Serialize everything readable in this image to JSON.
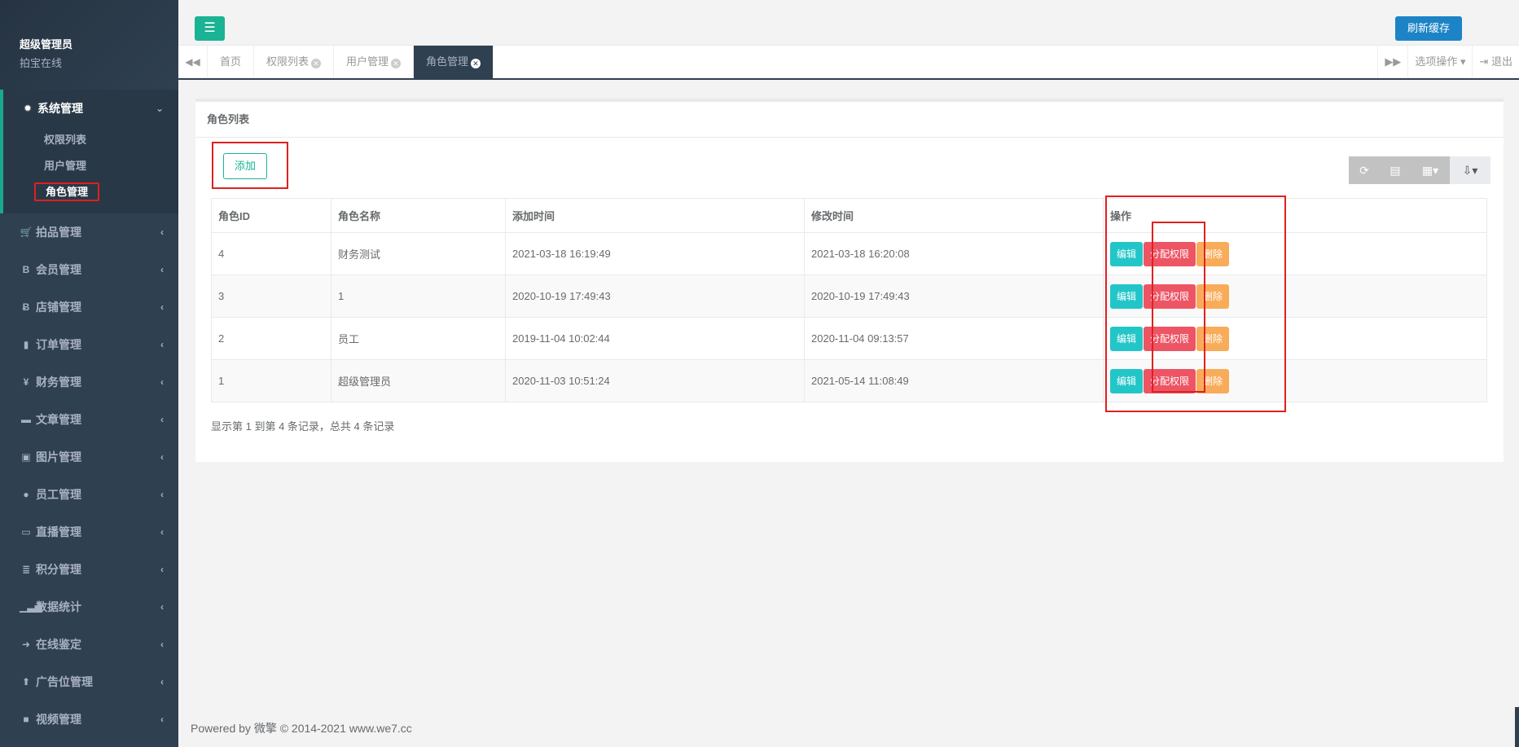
{
  "profile": {
    "name": "超级管理员",
    "role": "拍宝在线"
  },
  "sidebar": {
    "active_group": {
      "icon": "gear-icon",
      "label": "系统管理",
      "children": [
        "权限列表",
        "用户管理",
        "角色管理"
      ]
    },
    "items": [
      {
        "icon": "cart-icon",
        "label": "拍品管理"
      },
      {
        "icon": "bold-b-icon",
        "label": "会员管理"
      },
      {
        "icon": "bitcoin-icon",
        "label": "店铺管理"
      },
      {
        "icon": "book-icon",
        "label": "订单管理"
      },
      {
        "icon": "yen-icon",
        "label": "财务管理"
      },
      {
        "icon": "briefcase-icon",
        "label": "文章管理"
      },
      {
        "icon": "image-icon",
        "label": "图片管理"
      },
      {
        "icon": "user-icon",
        "label": "员工管理"
      },
      {
        "icon": "tv-icon",
        "label": "直播管理"
      },
      {
        "icon": "database-icon",
        "label": "积分管理"
      },
      {
        "icon": "bar-chart-icon",
        "label": "数据统计"
      },
      {
        "icon": "arrow-right-icon",
        "label": "在线鉴定"
      },
      {
        "icon": "arrow-up-icon",
        "label": "广告位管理"
      },
      {
        "icon": "video-icon",
        "label": "视频管理"
      }
    ]
  },
  "topbar": {
    "refresh_label": "刷新缓存"
  },
  "tabs": {
    "items": [
      "首页",
      "权限列表",
      "用户管理",
      "角色管理"
    ],
    "options_label": "选项操作",
    "logout_label": "退出"
  },
  "panel": {
    "title": "角色列表",
    "add_label": "添加",
    "columns": [
      "角色ID",
      "角色名称",
      "添加时间",
      "修改时间",
      "操作"
    ],
    "rows": [
      {
        "id": "4",
        "name": "财务测试",
        "created": "2021-03-18 16:19:49",
        "modified": "2021-03-18 16:20:08"
      },
      {
        "id": "3",
        "name": "1",
        "created": "2020-10-19 17:49:43",
        "modified": "2020-10-19 17:49:43"
      },
      {
        "id": "2",
        "name": "员工",
        "created": "2019-11-04 10:02:44",
        "modified": "2020-11-04 09:13:57"
      },
      {
        "id": "1",
        "name": "超级管理员",
        "created": "2020-11-03 10:51:24",
        "modified": "2021-05-14 11:08:49"
      }
    ],
    "actions": {
      "edit": "编辑",
      "assign": "分配权限",
      "delete": "删除"
    },
    "summary": "显示第 1 到第 4 条记录，总共 4 条记录"
  },
  "footer": "Powered by 微擎 © 2014-2021 www.we7.cc",
  "colors": {
    "sidebar": "#2f4050",
    "accent": "#1ab394",
    "edit": "#23c6c8",
    "assign": "#ed5565",
    "delete": "#f8ac59",
    "highlight": "#e02020"
  }
}
